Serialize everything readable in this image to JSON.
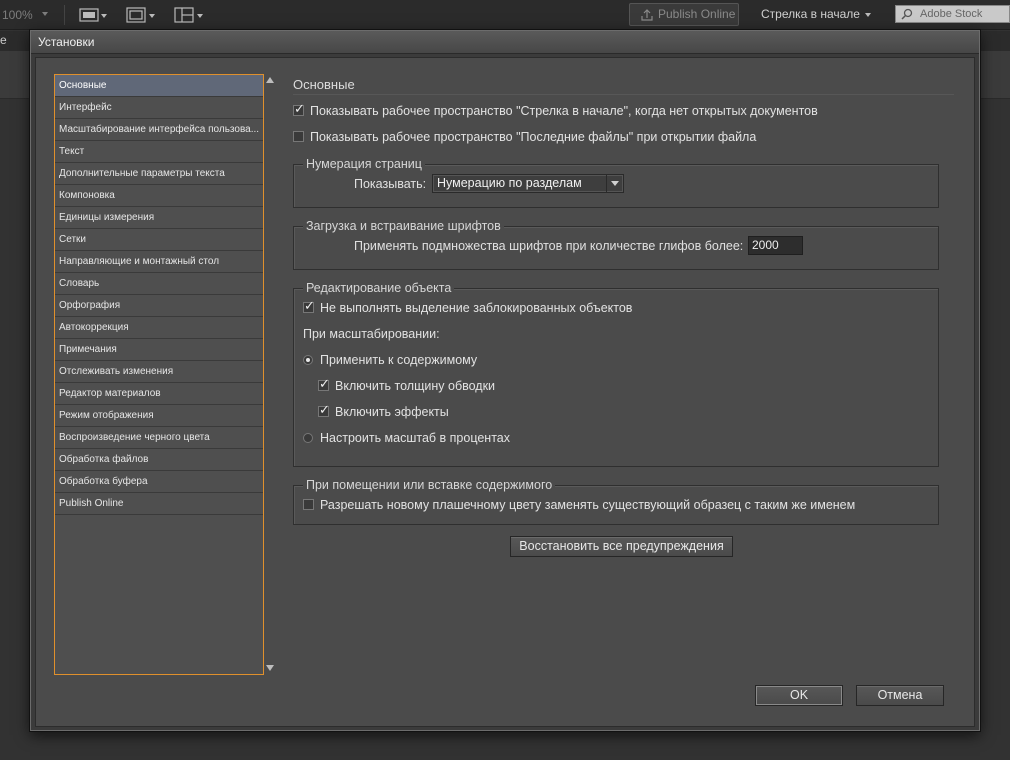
{
  "app": {
    "zoom": "100%",
    "publish_online": "Publish Online",
    "workspace": "Стрелка в начале",
    "stock_search_placeholder": "Adobe Stock",
    "menu_fragment": "е"
  },
  "dialog": {
    "title": "Установки",
    "categories": [
      "Основные",
      "Интерфейс",
      "Масштабирование интерфейса пользова...",
      "Текст",
      "Дополнительные параметры текста",
      "Компоновка",
      "Единицы измерения",
      "Сетки",
      "Направляющие и монтажный стол",
      "Словарь",
      "Орфография",
      "Автокоррекция",
      "Примечания",
      "Отслеживать изменения",
      "Редактор материалов",
      "Режим отображения",
      "Воспроизведение черного цвета",
      "Обработка файлов",
      "Обработка буфера",
      "Publish Online"
    ],
    "selected_category": 0,
    "section_title": "Основные",
    "show_workspace_start": "Показывать рабочее пространство \"Стрелка в начале\", когда нет открытых документов",
    "show_workspace_start_checked": true,
    "show_recent_files": "Показывать рабочее пространство \"Последние файлы\" при открытии файла",
    "show_recent_files_checked": false,
    "page_numbering": {
      "group_label": "Нумерация страниц",
      "show_label": "Показывать:",
      "show_value": "Нумерацию по разделам"
    },
    "font_downloading": {
      "group_label": "Загрузка и встраивание шрифтов",
      "subset_label": "Применять подмножества шрифтов при количестве глифов более:",
      "subset_value": "2000"
    },
    "object_editing": {
      "group_label": "Редактирование объекта",
      "no_select_locked": "Не выполнять выделение заблокированных объектов",
      "no_select_locked_checked": true,
      "when_scaling": "При масштабировании:",
      "apply_to_content": "Применить к содержимому",
      "apply_to_content_checked": true,
      "include_stroke": "Включить толщину обводки",
      "include_stroke_checked": true,
      "include_effects": "Включить эффекты",
      "include_effects_checked": true,
      "adjust_percentage": "Настроить масштаб в процентах",
      "adjust_percentage_checked": false
    },
    "placing": {
      "group_label": "При помещении или вставке содержимого",
      "allow_swatch": "Разрешать новому плашечному цвету заменять существующий образец с таким же именем",
      "allow_swatch_checked": false
    },
    "reset_warnings": "Восстановить все предупреждения",
    "ok": "OK",
    "cancel": "Отмена"
  },
  "colors": {
    "selection_border": "#e0902c",
    "selected_item": "#606878"
  }
}
